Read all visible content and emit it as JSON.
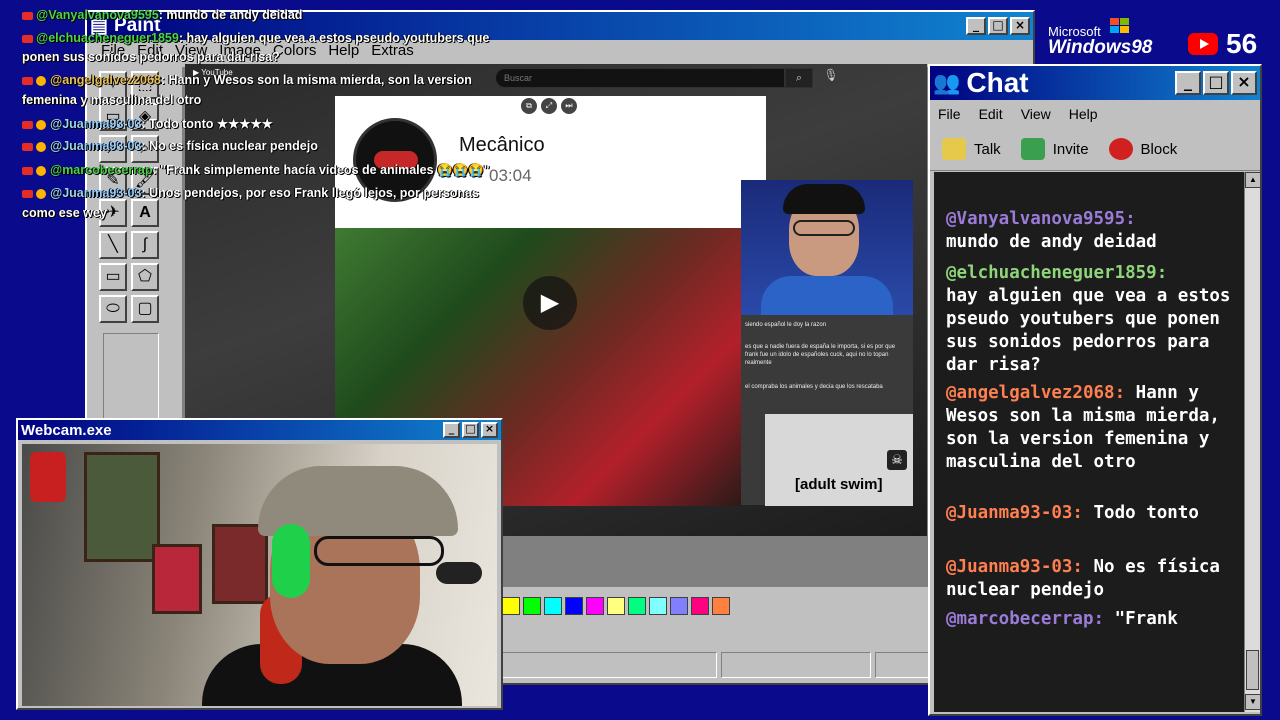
{
  "paint": {
    "title": "Paint",
    "menu": [
      "File",
      "Edit",
      "View",
      "Image",
      "Colors",
      "Help",
      "Extras"
    ],
    "palette": [
      "#ffff00",
      "#00ff00",
      "#00ffff",
      "#0000ff",
      "#ff00ff",
      "#ffff80",
      "#00ff80",
      "#80ffff",
      "#8080ff",
      "#ff0080",
      "#ff8040"
    ]
  },
  "youtube": {
    "logo": "YouTube",
    "search_placeholder": "Buscar",
    "channel": "Mecânico",
    "duration": "03:04",
    "subtitles": [
      "siendo español le doy la razon",
      "es que a nadie fuera de españa le importa, si es por que frank fue un idolo de españoles cuck, aqui no lo topan realmente",
      "el compraba los animales y decia que los rescataba"
    ],
    "watermark": "[adult swim]"
  },
  "overlay_chat": [
    {
      "user": "@Vanyalvanova9595",
      "text": ": mundo de andy deidad"
    },
    {
      "user": "@elchuacheneguer1859",
      "text": ": hay alguien que vea a estos pseudo youtubers que",
      "cont": "ponen sus sonidos pedorros para dar risa?"
    },
    {
      "user": "@angelgalvez2068",
      "text": ": Hann y Wesos son la misma mierda, son la version",
      "cont": "femenina y masculina del otro"
    },
    {
      "user": "@Juanma93-03",
      "text": ": Todo tonto ★★★★★"
    },
    {
      "user": "@Juanma93-03",
      "text": ": No es física nuclear pendejo"
    },
    {
      "user": "@marcobecerrap",
      "text": ": \"Frank simplemente hacía videos de animales 😭😭😭\""
    },
    {
      "user": "@Juanma93-03",
      "text": ": Unos pendejos, por eso Frank llegó lejos, por personas",
      "cont": "como ese wey"
    }
  ],
  "webcam": {
    "title": "Webcam.exe"
  },
  "branding": {
    "ms_small": "Microsoft",
    "ms_big": "Windows98",
    "viewers": "56"
  },
  "chat": {
    "title": "Chat",
    "menu": [
      "File",
      "Edit",
      "View",
      "Help"
    ],
    "tools": [
      "Talk",
      "Invite",
      "Block"
    ],
    "messages": [
      {
        "user": "@Vanyalvanova9595:",
        "text": "mundo de andy deidad",
        "color": "purple"
      },
      {
        "user": "@elchuacheneguer1859:",
        "text": "hay alguien que vea a estos pseudo youtubers que ponen sus sonidos pedorros para dar risa?",
        "color": "green"
      },
      {
        "user": "@angelgalvez2068:",
        "text": "Hann y Wesos son la misma mierda, son la version femenina y masculina del otro",
        "color": "orange"
      },
      {
        "user": "@Juanma93-03:",
        "text": "Todo tonto",
        "color": "orange"
      },
      {
        "user": "@Juanma93-03:",
        "text": "No es física nuclear pendejo",
        "color": "orange"
      },
      {
        "user": "@marcobecerrap:",
        "text": "\"Frank",
        "color": "purple"
      }
    ]
  }
}
